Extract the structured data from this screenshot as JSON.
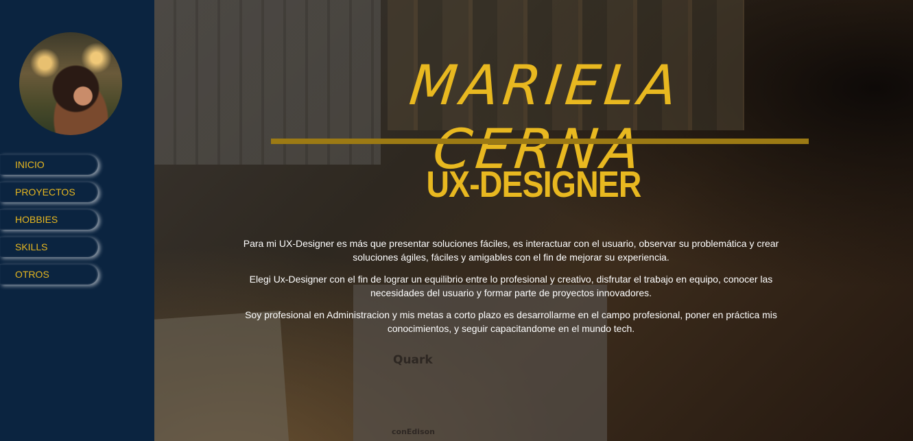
{
  "sidebar": {
    "avatar_alt": "Mariela Cerna",
    "nav": [
      {
        "label": "INICIO"
      },
      {
        "label": "PROYECTOS"
      },
      {
        "label": "HOBBIES"
      },
      {
        "label": "SKILLS"
      },
      {
        "label": "OTROS"
      }
    ]
  },
  "hero": {
    "name": "MARIELA CERNA",
    "role": "UX-DESIGNER",
    "paragraphs": [
      "Para mi UX-Designer es más que presentar soluciones fáciles, es interactuar con el usuario, observar su problemática y crear soluciones ágiles, fáciles y amigables con el fin de mejorar su experiencia.",
      "Elegi Ux-Designer con el fin de lograr un equilibrio entre lo profesional y creativo, disfrutar el trabajo en equipo, conocer las necesidades del usuario y formar parte de proyectos innovadores.",
      "Soy profesional en Administracion y mis metas a corto plazo es desarrollarme en el campo profesional, poner en práctica mis conocimientos, y seguir capacitandome en el mundo tech."
    ]
  },
  "background": {
    "logos": [
      "Quark",
      "conEdison"
    ]
  },
  "colors": {
    "sidebar_bg": "#0b2440",
    "accent": "#e8b820",
    "rule": "#9c7a14"
  }
}
